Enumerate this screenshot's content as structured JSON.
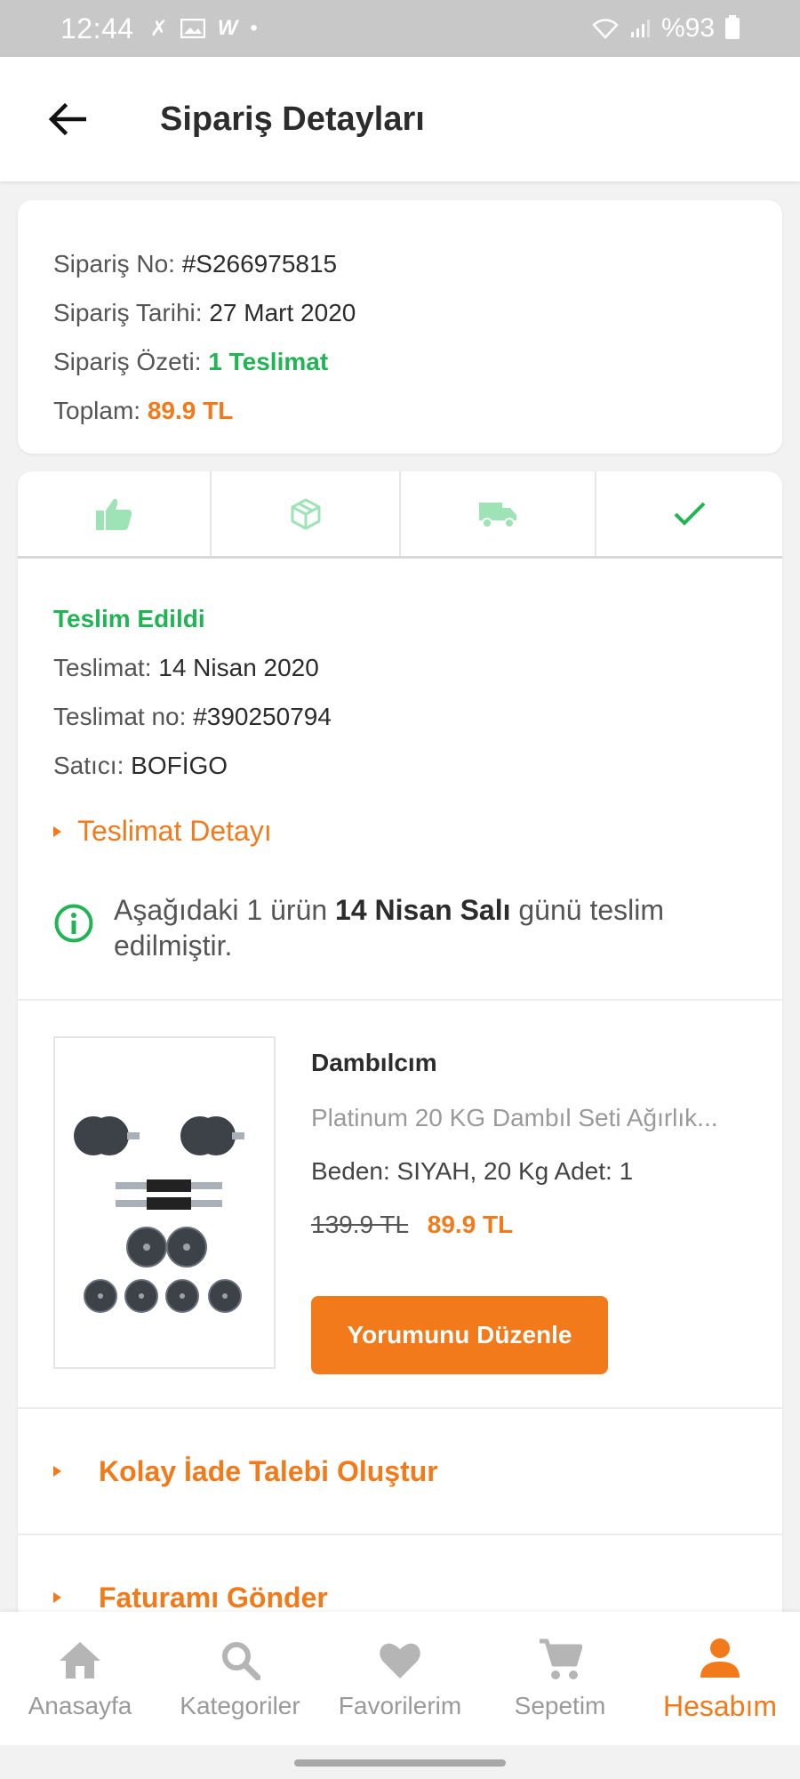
{
  "status_bar": {
    "time": "12:44",
    "battery": "%93"
  },
  "header": {
    "title": "Sipariş Detayları"
  },
  "order_summary": {
    "order_no_label": "Sipariş No:",
    "order_no_value": "#S266975815",
    "order_date_label": "Sipariş Tarihi:",
    "order_date_value": "27 Mart 2020",
    "order_summary_label": "Sipariş Özeti:",
    "order_summary_value": "1 Teslimat",
    "total_label": "Toplam:",
    "total_value": "89.9 TL"
  },
  "progress_steps": [
    {
      "icon": "thumbs-up-icon",
      "color": "#9ee3b6"
    },
    {
      "icon": "package-icon",
      "color": "#9ee3b6"
    },
    {
      "icon": "truck-icon",
      "color": "#9ee3b6"
    },
    {
      "icon": "check-icon",
      "color": "#22b454"
    }
  ],
  "delivery": {
    "status": "Teslim Edildi",
    "date_label": "Teslimat:",
    "date_value": "14 Nisan 2020",
    "delivery_no_label": "Teslimat no:",
    "delivery_no_value": "#390250794",
    "seller_label": "Satıcı:",
    "seller_value": "BOFİGO",
    "detail_toggle": "Teslimat Detayı",
    "notice_part1": "Aşağıdaki 1 ürün ",
    "notice_bold": "14 Nisan Salı",
    "notice_part2": " günü teslim edilmiştir."
  },
  "product": {
    "brand": "Dambılcım",
    "name": "Platinum 20 KG Dambıl Seti Ağırlık...",
    "variant": "Beden: SIYAH, 20 Kg Adet: 1",
    "old_price": "139.9 TL",
    "new_price": "89.9 TL",
    "review_button": "Yorumunu Düzenle"
  },
  "actions": {
    "return_request": "Kolay İade Talebi Oluştur",
    "send_invoice": "Faturamı Gönder"
  },
  "bottom_nav": [
    {
      "label": "Anasayfa",
      "icon": "home-icon",
      "active": false
    },
    {
      "label": "Kategoriler",
      "icon": "search-icon",
      "active": false
    },
    {
      "label": "Favorilerim",
      "icon": "heart-icon",
      "active": false
    },
    {
      "label": "Sepetim",
      "icon": "cart-icon",
      "active": false
    },
    {
      "label": "Hesabım",
      "icon": "user-icon",
      "active": true
    }
  ],
  "colors": {
    "accent": "#f27a1a",
    "success": "#22b454"
  }
}
